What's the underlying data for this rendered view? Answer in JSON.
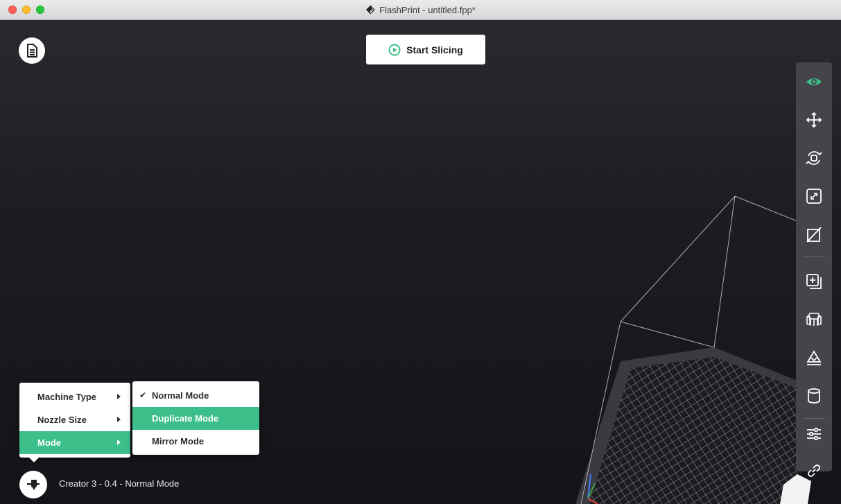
{
  "window": {
    "title": "FlashPrint - untitled.fpp*"
  },
  "toolbar_top": {
    "start_slicing_label": "Start Slicing"
  },
  "right_toolbar": {
    "tools": [
      {
        "icon": "eye-icon",
        "active": true
      },
      {
        "icon": "move-icon"
      },
      {
        "icon": "rotate-icon"
      },
      {
        "icon": "scale-icon"
      },
      {
        "icon": "cut-icon"
      },
      {
        "icon": "add-object-icon"
      },
      {
        "icon": "supports-icon"
      },
      {
        "icon": "place-on-bed-icon"
      },
      {
        "icon": "cylinder-icon"
      },
      {
        "icon": "settings-sliders-icon"
      },
      {
        "icon": "link-icon"
      }
    ]
  },
  "machine": {
    "status_label": "Creator 3 - 0.4 - Normal Mode"
  },
  "machine_menu": {
    "items": [
      {
        "label": "Machine Type"
      },
      {
        "label": "Nozzle Size"
      },
      {
        "label": "Mode",
        "active": true
      }
    ]
  },
  "mode_submenu": {
    "items": [
      {
        "label": "Normal Mode",
        "checked": true
      },
      {
        "label": "Duplicate Mode",
        "highlighted": true
      },
      {
        "label": "Mirror Mode"
      }
    ]
  },
  "colors": {
    "accent": "#3dbf8b",
    "toolbar_bg": "#45444b",
    "viewport_bg": "#1c1b21"
  }
}
